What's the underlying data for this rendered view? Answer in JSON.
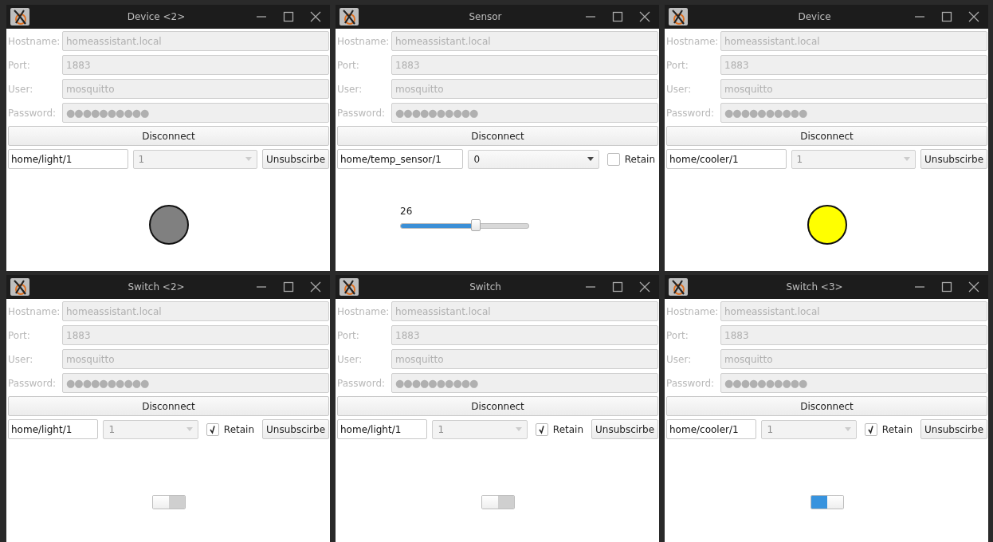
{
  "windows": [
    {
      "title": "Device <2>",
      "fields": [
        {
          "label": "Hostname:",
          "value": "homeassistant.local",
          "disabled": true
        },
        {
          "label": "Port:",
          "value": "1883",
          "disabled": true
        },
        {
          "label": "User:",
          "value": "mosquitto",
          "disabled": true
        },
        {
          "label": "Password:",
          "value": "●●●●●●●●●●",
          "disabled": true
        }
      ],
      "connect_button": "Disconnect",
      "topic": "home/light/1",
      "qos": {
        "value": "1",
        "disabled": true
      },
      "unsubscribe_button": "Unsubscirbe",
      "widget": {
        "kind": "lamp",
        "color": "#808080"
      }
    },
    {
      "title": "Sensor",
      "fields": [
        {
          "label": "Hostname:",
          "value": "homeassistant.local",
          "disabled": true
        },
        {
          "label": "Port:",
          "value": "1883",
          "disabled": true
        },
        {
          "label": "User:",
          "value": "mosquitto",
          "disabled": true
        },
        {
          "label": "Password:",
          "value": "●●●●●●●●●●",
          "disabled": true
        }
      ],
      "connect_button": "Disconnect",
      "topic": "home/temp_sensor/1",
      "qos": {
        "value": "0",
        "disabled": false
      },
      "retain": {
        "label": "Retain",
        "checked": false
      },
      "widget": {
        "kind": "slider",
        "reading": "26",
        "level": 0.59
      }
    },
    {
      "title": "Device",
      "fields": [
        {
          "label": "Hostname:",
          "value": "homeassistant.local",
          "disabled": true
        },
        {
          "label": "Port:",
          "value": "1883",
          "disabled": true
        },
        {
          "label": "User:",
          "value": "mosquitto",
          "disabled": true
        },
        {
          "label": "Password:",
          "value": "●●●●●●●●●●",
          "disabled": true
        }
      ],
      "connect_button": "Disconnect",
      "topic": "home/cooler/1",
      "qos": {
        "value": "1",
        "disabled": true
      },
      "unsubscribe_button": "Unsubscirbe",
      "widget": {
        "kind": "lamp",
        "color": "#ffff00"
      }
    },
    {
      "title": "Switch <2>",
      "fields": [
        {
          "label": "Hostname:",
          "value": "homeassistant.local",
          "disabled": true
        },
        {
          "label": "Port:",
          "value": "1883",
          "disabled": true
        },
        {
          "label": "User:",
          "value": "mosquitto",
          "disabled": true
        },
        {
          "label": "Password:",
          "value": "●●●●●●●●●●",
          "disabled": true
        }
      ],
      "connect_button": "Disconnect",
      "topic": "home/light/1",
      "qos": {
        "value": "1",
        "disabled": true
      },
      "retain": {
        "label": "Retain",
        "checked": true
      },
      "unsubscribe_button": "Unsubscirbe",
      "widget": {
        "kind": "toggle",
        "on": false
      }
    },
    {
      "title": "Switch",
      "fields": [
        {
          "label": "Hostname:",
          "value": "homeassistant.local",
          "disabled": true
        },
        {
          "label": "Port:",
          "value": "1883",
          "disabled": true
        },
        {
          "label": "User:",
          "value": "mosquitto",
          "disabled": true
        },
        {
          "label": "Password:",
          "value": "●●●●●●●●●●",
          "disabled": true
        }
      ],
      "connect_button": "Disconnect",
      "topic": "home/light/1",
      "qos": {
        "value": "1",
        "disabled": true
      },
      "retain": {
        "label": "Retain",
        "checked": true
      },
      "unsubscribe_button": "Unsubscirbe",
      "widget": {
        "kind": "toggle",
        "on": false
      }
    },
    {
      "title": "Switch <3>",
      "fields": [
        {
          "label": "Hostname:",
          "value": "homeassistant.local",
          "disabled": true
        },
        {
          "label": "Port:",
          "value": "1883",
          "disabled": true
        },
        {
          "label": "User:",
          "value": "mosquitto",
          "disabled": true
        },
        {
          "label": "Password:",
          "value": "●●●●●●●●●●",
          "disabled": true
        }
      ],
      "connect_button": "Disconnect",
      "topic": "home/cooler/1",
      "qos": {
        "value": "1",
        "disabled": true
      },
      "retain": {
        "label": "Retain",
        "checked": true
      },
      "unsubscribe_button": "Unsubscirbe",
      "widget": {
        "kind": "toggle",
        "on": true
      }
    }
  ]
}
